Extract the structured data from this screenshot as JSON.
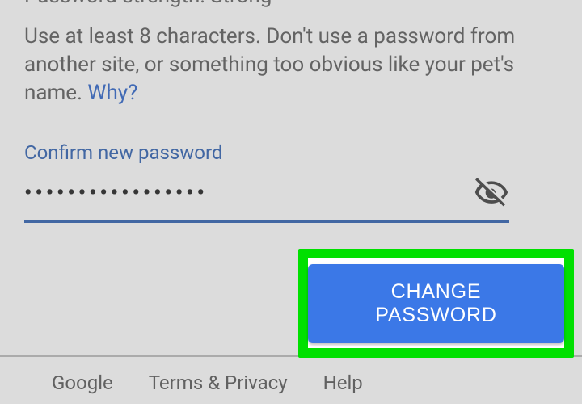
{
  "strength": {
    "label": "Password strength:",
    "value": "Strong"
  },
  "hint": {
    "text": "Use at least 8 characters. Don't use a password from another site, or something too obvious like your pet's name.",
    "why": "Why?"
  },
  "confirm": {
    "label": "Confirm new password",
    "masked": "•••••••••••••••••"
  },
  "button": {
    "label": "CHANGE PASSWORD"
  },
  "footer": {
    "google": "Google",
    "terms": "Terms & Privacy",
    "help": "Help"
  }
}
